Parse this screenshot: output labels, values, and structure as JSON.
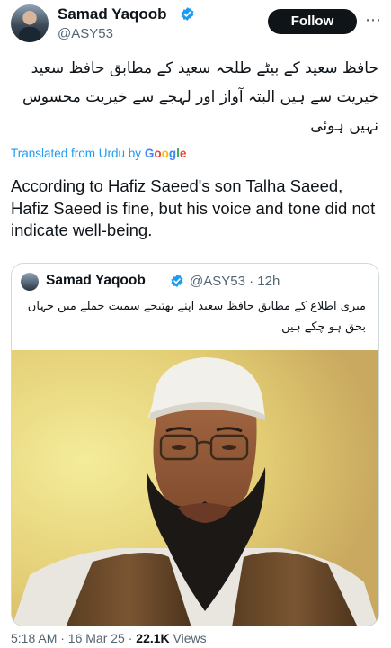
{
  "author": {
    "name": "Samad Yaqoob",
    "handle": "@ASY53"
  },
  "follow_label": "Follow",
  "more_label": "⋯",
  "post": {
    "urdu_text": "حافظ سعید کے بیٹے طلحہ سعید کے مطابق حافظ سعید خیریت سے ہیں البتہ آواز اور لہجے سے خیریت محسوس نہیں ہوئی",
    "translated_prefix": "Translated from Urdu by",
    "translator": "Google",
    "english_text": "According to Hafiz Saeed's son Talha Saeed, Hafiz Saeed is fine, but his voice and tone did not indicate well-being."
  },
  "quoted": {
    "name": "Samad Yaqoob",
    "meta": "@ASY53 · 12h",
    "urdu_text": "میری اطلاع کے مطابق حافظ سعید اپنے بھتیجے سمیت حملے میں جہاں بحق ہو چکے ہیں"
  },
  "footer": {
    "time_date": "5:18 AM · 16 Mar 25 · ",
    "views_count": "22.1K",
    "views_label": " Views"
  },
  "colors": {
    "accent": "#1d9bf0",
    "text": "#0f1419",
    "muted": "#536471"
  }
}
